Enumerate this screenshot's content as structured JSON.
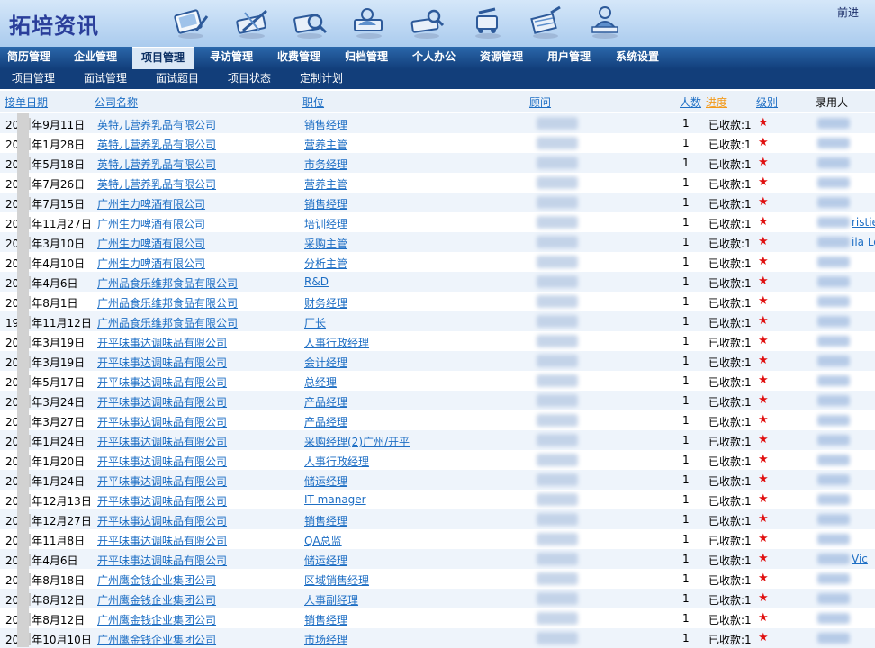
{
  "app": {
    "title": "拓培资讯",
    "forward_label": "前进"
  },
  "toolbar_icons": [
    "notebook-pen-icon",
    "toolbox-pencil-icon",
    "magnifier-tools-icon",
    "people-tools-icon",
    "ruler-tools-icon",
    "cart-pencil-icon",
    "building-pen-icon",
    "meeting-icon"
  ],
  "nav": [
    {
      "label": "简历管理",
      "active": false
    },
    {
      "label": "企业管理",
      "active": false
    },
    {
      "label": "项目管理",
      "active": true
    },
    {
      "label": "寻访管理",
      "active": false
    },
    {
      "label": "收费管理",
      "active": false
    },
    {
      "label": "归档管理",
      "active": false
    },
    {
      "label": "个人办公",
      "active": false
    },
    {
      "label": "资源管理",
      "active": false
    },
    {
      "label": "用户管理",
      "active": false
    },
    {
      "label": "系统设置",
      "active": false
    }
  ],
  "subnav": [
    "项目管理",
    "面试管理",
    "面试题目",
    "项目状态",
    "定制计划"
  ],
  "table": {
    "headers": {
      "date": "接单日期",
      "company": "公司名称",
      "position": "职位",
      "consultant": "顾问",
      "count": "人数",
      "progress": "进度",
      "level": "级别",
      "recorder": "录用人"
    },
    "rows": [
      {
        "date_prefix": "20",
        "date": "年9月11日",
        "company": "英特儿营养乳品有限公司",
        "position": "销售经理",
        "count": "1",
        "status": "已收款:1",
        "star": "★",
        "extra": ""
      },
      {
        "date_prefix": "20",
        "date": "年1月28日",
        "company": "英特儿营养乳品有限公司",
        "position": "营养主管",
        "count": "1",
        "status": "已收款:1",
        "star": "★",
        "extra": ""
      },
      {
        "date_prefix": "20",
        "date": "年5月18日",
        "company": "英特儿营养乳品有限公司",
        "position": "市务经理",
        "count": "1",
        "status": "已收款:1",
        "star": "★",
        "extra": ""
      },
      {
        "date_prefix": "20",
        "date": "年7月26日",
        "company": "英特儿营养乳品有限公司",
        "position": "营养主管",
        "count": "1",
        "status": "已收款:1",
        "star": "★",
        "extra": ""
      },
      {
        "date_prefix": "20",
        "date": "年7月15日",
        "company": "广州生力啤酒有限公司",
        "position": "销售经理",
        "count": "1",
        "status": "已收款:1",
        "star": "★",
        "extra": ""
      },
      {
        "date_prefix": "20",
        "date": "年11月27日",
        "company": "广州生力啤酒有限公司",
        "position": "培训经理",
        "count": "1",
        "status": "已收款:1",
        "star": "★",
        "extra": "ristie"
      },
      {
        "date_prefix": "20",
        "date": "年3月10日",
        "company": "广州生力啤酒有限公司",
        "position": "采购主管",
        "count": "1",
        "status": "已收款:1",
        "star": "★",
        "extra": "ila Lo"
      },
      {
        "date_prefix": "20",
        "date": "年4月10日",
        "company": "广州生力啤酒有限公司",
        "position": "分析主管",
        "count": "1",
        "status": "已收款:1",
        "star": "★",
        "extra": ""
      },
      {
        "date_prefix": "20",
        "date": "年4月6日",
        "company": "广州品食乐维邦食品有限公司",
        "position": "R&D",
        "count": "1",
        "status": "已收款:1",
        "star": "★",
        "extra": ""
      },
      {
        "date_prefix": "20",
        "date": "年8月1日",
        "company": "广州品食乐维邦食品有限公司",
        "position": "财务经理",
        "count": "1",
        "status": "已收款:1",
        "star": "★",
        "extra": ""
      },
      {
        "date_prefix": "19",
        "date": "年11月12日",
        "company": "广州品食乐维邦食品有限公司",
        "position": "厂长",
        "count": "1",
        "status": "已收款:1",
        "star": "★",
        "extra": ""
      },
      {
        "date_prefix": "20",
        "date": "年3月19日",
        "company": "开平味事达调味品有限公司",
        "position": "人事行政经理",
        "count": "1",
        "status": "已收款:1",
        "star": "★",
        "extra": ""
      },
      {
        "date_prefix": "20",
        "date": "年3月19日",
        "company": "开平味事达调味品有限公司",
        "position": "会计经理",
        "count": "1",
        "status": "已收款:1",
        "star": "★",
        "extra": ""
      },
      {
        "date_prefix": "20",
        "date": "年5月17日",
        "company": "开平味事达调味品有限公司",
        "position": "总经理",
        "count": "1",
        "status": "已收款:1",
        "star": "★",
        "extra": ""
      },
      {
        "date_prefix": "20",
        "date": "年3月24日",
        "company": "开平味事达调味品有限公司",
        "position": "产品经理",
        "count": "1",
        "status": "已收款:1",
        "star": "★",
        "extra": ""
      },
      {
        "date_prefix": "20",
        "date": "年3月27日",
        "company": "开平味事达调味品有限公司",
        "position": "产品经理",
        "count": "1",
        "status": "已收款:1",
        "star": "★",
        "extra": ""
      },
      {
        "date_prefix": "20",
        "date": "年1月24日",
        "company": "开平味事达调味品有限公司",
        "position": "采购经理(2)广州/开平",
        "count": "1",
        "status": "已收款:1",
        "star": "★",
        "extra": ""
      },
      {
        "date_prefix": "20",
        "date": "年1月20日",
        "company": "开平味事达调味品有限公司",
        "position": "人事行政经理",
        "count": "1",
        "status": "已收款:1",
        "star": "★",
        "extra": ""
      },
      {
        "date_prefix": "20",
        "date": "年1月24日",
        "company": "开平味事达调味品有限公司",
        "position": "储运经理",
        "count": "1",
        "status": "已收款:1",
        "star": "★",
        "extra": ""
      },
      {
        "date_prefix": "20",
        "date": "年12月13日",
        "company": "开平味事达调味品有限公司",
        "position": "IT manager",
        "count": "1",
        "status": "已收款:1",
        "star": "★",
        "extra": ""
      },
      {
        "date_prefix": "20",
        "date": "年12月27日",
        "company": "开平味事达调味品有限公司",
        "position": "销售经理",
        "count": "1",
        "status": "已收款:1",
        "star": "★",
        "extra": ""
      },
      {
        "date_prefix": "20",
        "date": "年11月8日",
        "company": "开平味事达调味品有限公司",
        "position": "QA总监",
        "count": "1",
        "status": "已收款:1",
        "star": "★",
        "extra": ""
      },
      {
        "date_prefix": "20",
        "date": "年4月6日",
        "company": "开平味事达调味品有限公司",
        "position": "储运经理",
        "count": "1",
        "status": "已收款:1",
        "star": "★",
        "extra": "Vic"
      },
      {
        "date_prefix": "20",
        "date": "年8月18日",
        "company": "广州鹰金钱企业集团公司",
        "position": "区域销售经理",
        "count": "1",
        "status": "已收款:1",
        "star": "★",
        "extra": ""
      },
      {
        "date_prefix": "20",
        "date": "年8月12日",
        "company": "广州鹰金钱企业集团公司",
        "position": "人事副经理",
        "count": "1",
        "status": "已收款:1",
        "star": "★",
        "extra": ""
      },
      {
        "date_prefix": "20",
        "date": "年8月12日",
        "company": "广州鹰金钱企业集团公司",
        "position": "销售经理",
        "count": "1",
        "status": "已收款:1",
        "star": "★",
        "extra": ""
      },
      {
        "date_prefix": "20",
        "date": "年10月10日",
        "company": "广州鹰金钱企业集团公司",
        "position": "市场经理",
        "count": "1",
        "status": "已收款:1",
        "star": "★",
        "extra": ""
      }
    ]
  },
  "colors": {
    "nav_bg": "#1a4d8c",
    "header_bg": "#bcd6f2",
    "link": "#1d6ec4",
    "progress_header": "#f39a1b",
    "star": "#e01010"
  }
}
